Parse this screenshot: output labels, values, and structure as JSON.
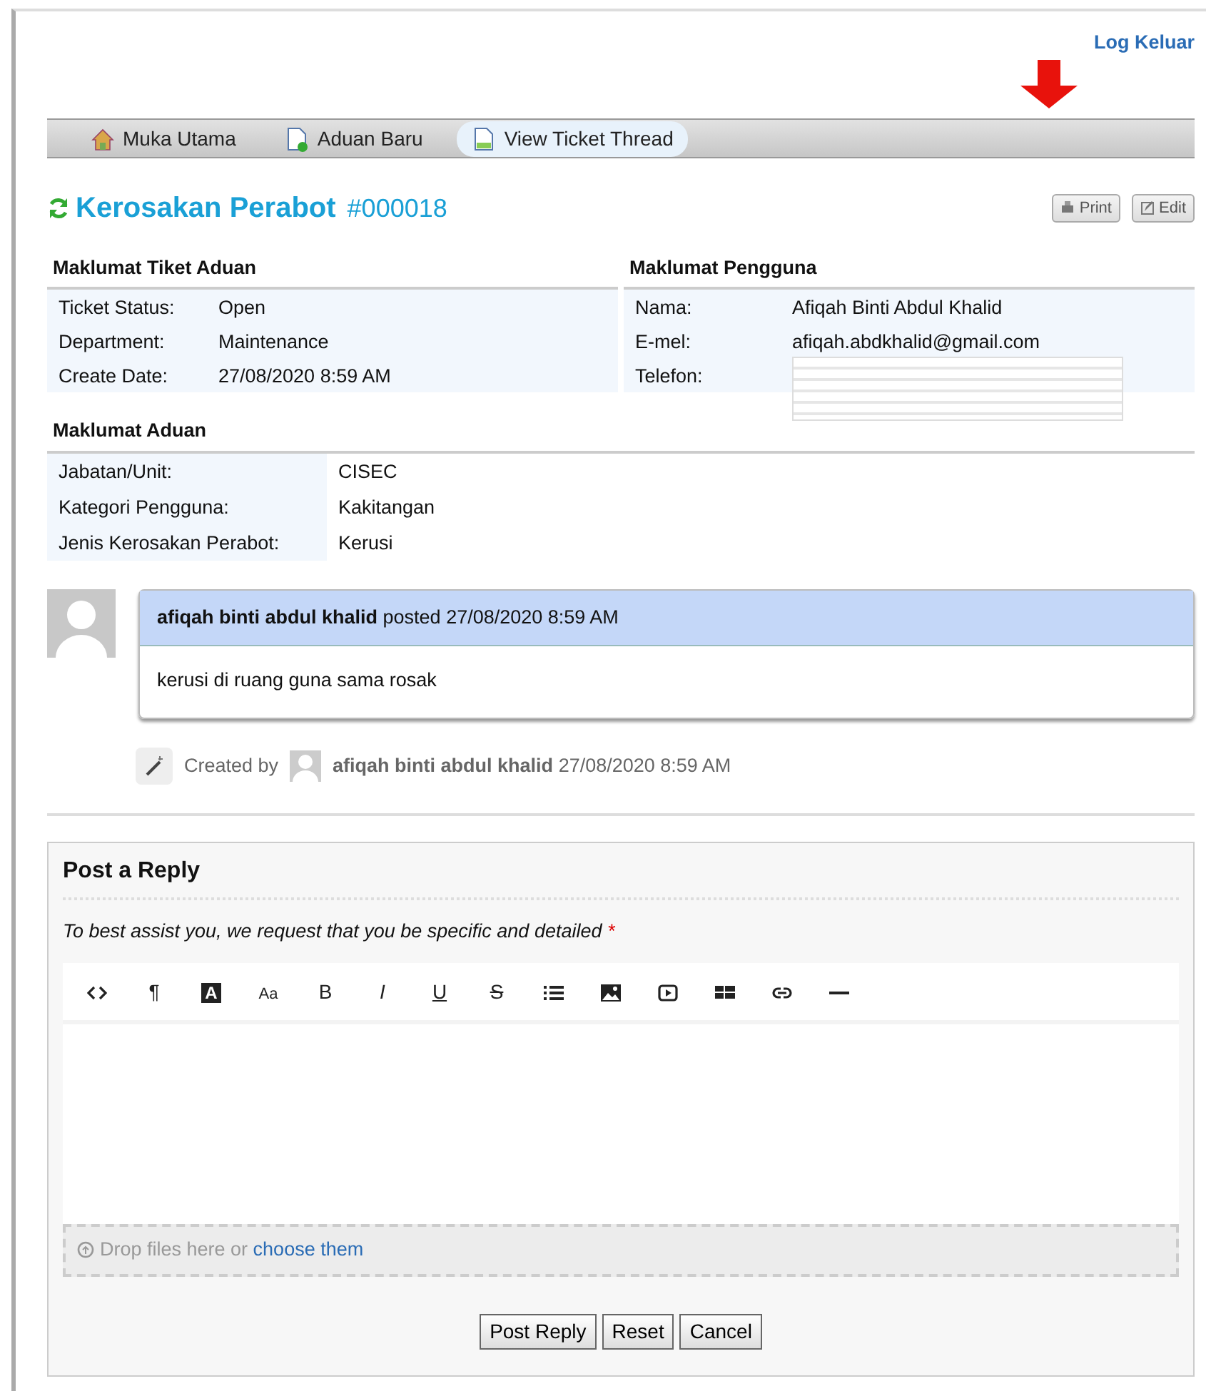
{
  "header": {
    "logout": "Log Keluar"
  },
  "nav_tabs": [
    {
      "label": "Muka Utama",
      "kind": "home",
      "selected": false
    },
    {
      "label": "Aduan Baru",
      "kind": "newdoc",
      "selected": false
    },
    {
      "label": "View Ticket Thread",
      "kind": "doc",
      "selected": true
    }
  ],
  "ticket": {
    "title": "Kerosakan Perabot",
    "number": "#000018",
    "actions": [
      "Print",
      "Edit"
    ]
  },
  "ticket_info": {
    "heading": "Maklumat Tiket Aduan",
    "rows": [
      {
        "label": "Ticket Status:",
        "value": "Open"
      },
      {
        "label": "Department:",
        "value": "Maintenance"
      },
      {
        "label": "Create Date:",
        "value": "27/08/2020 8:59 AM"
      }
    ]
  },
  "user_info": {
    "heading": "Maklumat Pengguna",
    "rows": [
      {
        "label": "Nama:",
        "value": "Afiqah Binti Abdul Khalid"
      },
      {
        "label": "E-mel:",
        "value": "afiqah.abdkhalid@gmail.com"
      },
      {
        "label": "Telefon:",
        "redacted": true
      }
    ]
  },
  "complaint_info": {
    "heading": "Maklumat Aduan",
    "rows": [
      {
        "label": "Jabatan/Unit:",
        "value": "CISEC"
      },
      {
        "label": "Kategori Pengguna:",
        "value": "Kakitangan"
      },
      {
        "label": "Jenis Kerosakan Perabot:",
        "value": "Kerusi"
      }
    ]
  },
  "thread": {
    "author": "afiqah binti abdul khalid",
    "posted": "posted 27/08/2020 8:59 AM",
    "body": "kerusi di ruang guna sama rosak"
  },
  "event": {
    "prefix": "Created by",
    "author": "afiqah binti abdul khalid",
    "time": "27/08/2020 8:59 AM"
  },
  "reply": {
    "title": "Post a Reply",
    "hint": "To best assist you, we request that you be specific and detailed",
    "required_mark": "*",
    "toolbar": [
      {
        "kind": "code"
      },
      {
        "kind": "char",
        "label": "¶"
      },
      {
        "kind": "inverse",
        "label": "A"
      },
      {
        "kind": "fontsize",
        "label": "Aa"
      },
      {
        "kind": "bold",
        "label": "B"
      },
      {
        "kind": "italic",
        "label": "I"
      },
      {
        "kind": "underline",
        "label": "U"
      },
      {
        "kind": "strike",
        "label": "S"
      },
      {
        "kind": "list"
      },
      {
        "kind": "image"
      },
      {
        "kind": "video"
      },
      {
        "kind": "table"
      },
      {
        "kind": "link"
      },
      {
        "kind": "rule"
      }
    ],
    "dropzone": {
      "text": "Drop files here or",
      "link": "choose them"
    },
    "buttons": [
      "Post Reply",
      "Reset",
      "Cancel"
    ]
  }
}
